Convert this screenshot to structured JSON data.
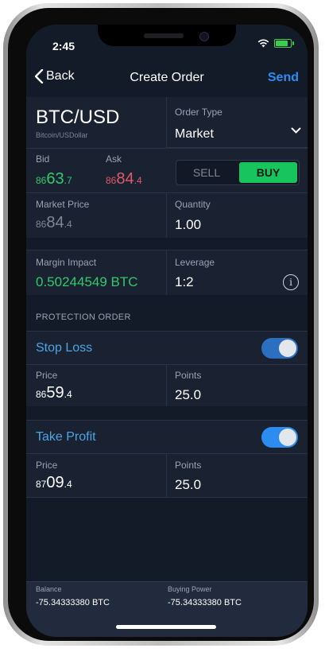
{
  "status_bar": {
    "time": "2:45"
  },
  "header": {
    "back_label": "Back",
    "title": "Create Order",
    "send_label": "Send"
  },
  "instrument": {
    "pair": "BTC/USD",
    "name": "Bitcoin/USDollar"
  },
  "order_type": {
    "label": "Order Type",
    "value": "Market"
  },
  "quote": {
    "bid_label": "Bid",
    "bid_prefix": "86",
    "bid_main": "63",
    "bid_suffix": ".7",
    "ask_label": "Ask",
    "ask_prefix": "86",
    "ask_main": "84",
    "ask_suffix": ".4"
  },
  "side": {
    "sell_label": "SELL",
    "buy_label": "BUY",
    "selected": "BUY"
  },
  "market_price": {
    "label": "Market Price",
    "prefix": "86",
    "main": "84",
    "suffix": ".4"
  },
  "quantity": {
    "label": "Quantity",
    "value": "1.00"
  },
  "margin": {
    "label": "Margin Impact",
    "value": "0.50244549 BTC"
  },
  "leverage": {
    "label": "Leverage",
    "value": "1:2"
  },
  "protection": {
    "title": "PROTECTION ORDER"
  },
  "stop_loss": {
    "title": "Stop Loss",
    "enabled": true,
    "price_label": "Price",
    "price_prefix": "86",
    "price_main": "59",
    "price_suffix": ".4",
    "points_label": "Points",
    "points_value": "25.0"
  },
  "take_profit": {
    "title": "Take Profit",
    "enabled": true,
    "price_label": "Price",
    "price_prefix": "87",
    "price_main": "09",
    "price_suffix": ".4",
    "points_label": "Points",
    "points_value": "25.0"
  },
  "footer": {
    "balance_label": "Balance",
    "balance_value": "-75.34333380 BTC",
    "buying_power_label": "Buying Power",
    "buying_power_value": "-75.34333380 BTC"
  },
  "colors": {
    "accent": "#2d8cf0",
    "buy": "#17c45d",
    "bid": "#2fcb6a",
    "ask": "#e05a68",
    "background": "#141b28"
  }
}
